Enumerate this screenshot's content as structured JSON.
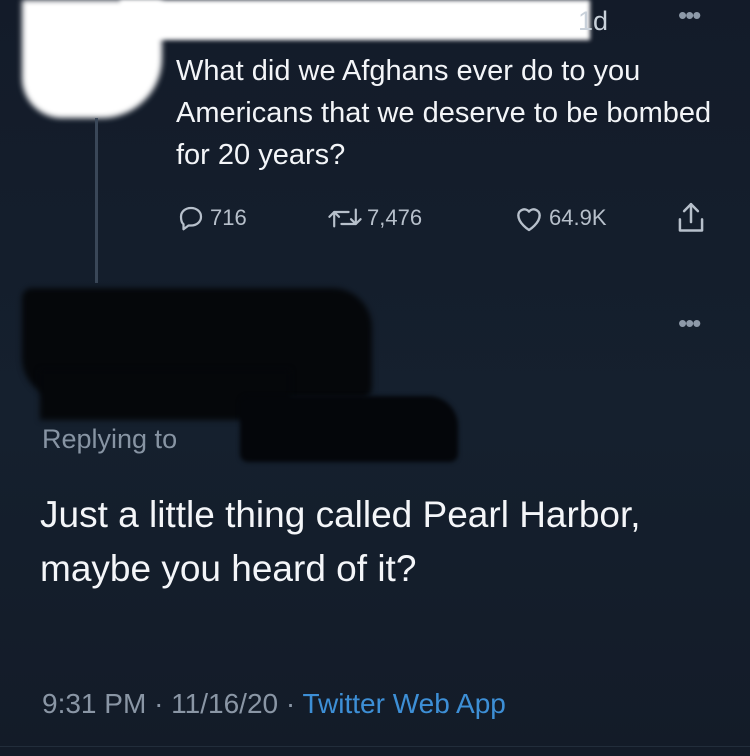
{
  "original_tweet": {
    "time_ago": "1d",
    "text": "What did we Afghans ever do to you Americans that we deserve to be bombed for 20 years?",
    "actions": {
      "replies": "716",
      "retweets": "7,476",
      "likes": "64.9K"
    },
    "more_icon": "more-horizontal-icon"
  },
  "reply_tweet": {
    "replying_to_label": "Replying to",
    "text": "Just a little thing called Pearl Harbor, maybe you heard of it?",
    "timestamp_time": "9:31 PM",
    "separator": "·",
    "timestamp_date": "11/16/20",
    "source": "Twitter Web App",
    "more_icon": "more-horizontal-icon"
  },
  "colors": {
    "background": "#141d2b",
    "text_primary": "#f3f5f8",
    "text_secondary": "#8a96a5",
    "link": "#3d8fd6"
  }
}
